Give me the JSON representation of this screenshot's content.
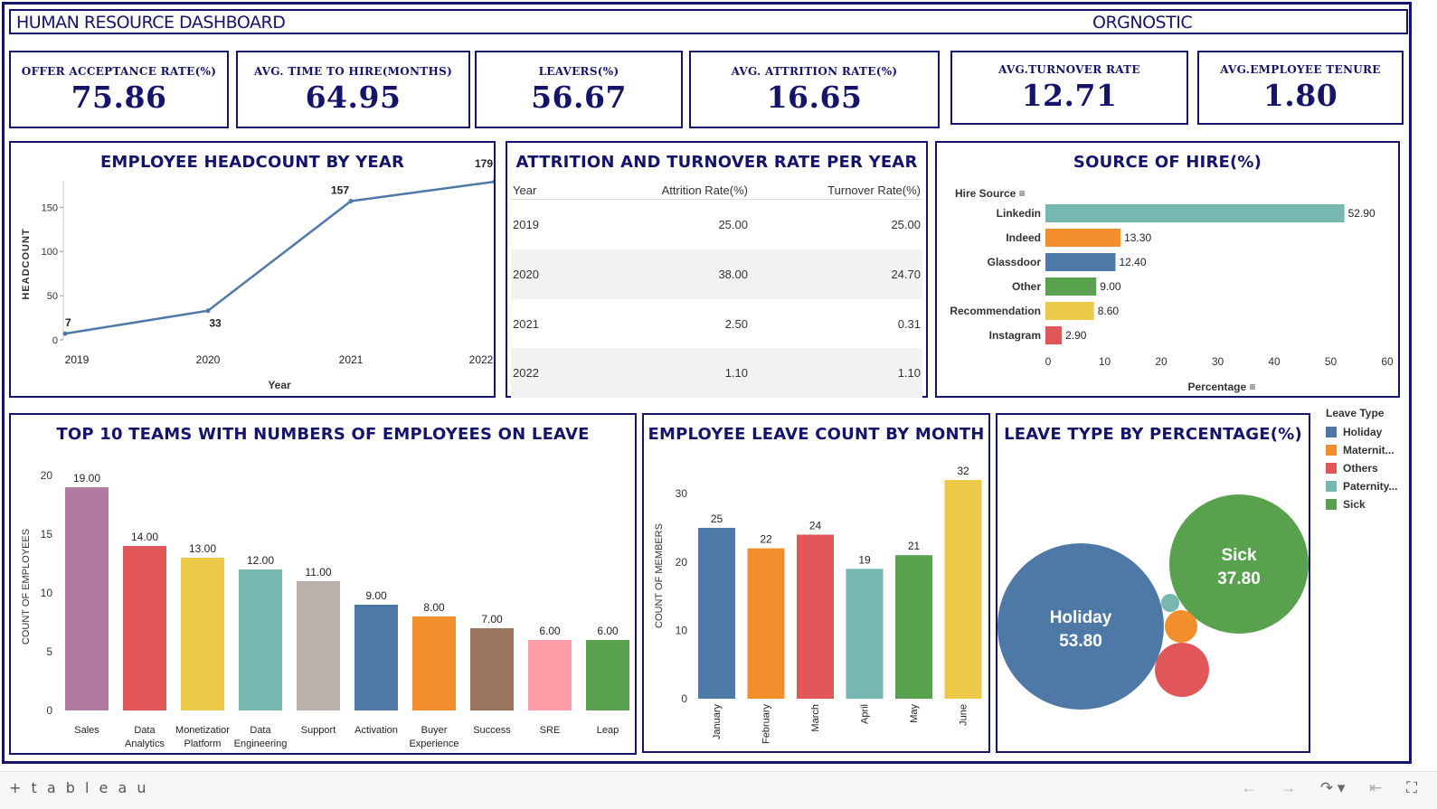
{
  "header": {
    "title": "HUMAN RESOURCE DASHBOARD",
    "org": "ORGNOSTIC"
  },
  "kpis": [
    {
      "label": "OFFER ACCEPTANCE RATE(%)",
      "value": "75.86"
    },
    {
      "label": "AVG. TIME TO HIRE(MONTHS)",
      "value": "64.95"
    },
    {
      "label": "LEAVERS(%)",
      "value": "56.67"
    },
    {
      "label": "AVG. ATTRITION RATE(%)",
      "value": "16.65"
    },
    {
      "label": "AVG.TURNOVER RATE",
      "value": "12.71"
    },
    {
      "label": "AVG.EMPLOYEE TENURE",
      "value": "1.80"
    }
  ],
  "headcount": {
    "title": "EMPLOYEE HEADCOUNT BY YEAR",
    "chart_data": {
      "type": "line",
      "x": [
        "2019",
        "2020",
        "2021",
        "2022"
      ],
      "values": [
        7,
        33,
        157,
        179
      ],
      "xlabel": "Year",
      "ylabel": "HEADCOUNT",
      "yticks": [
        0,
        50,
        100,
        150
      ],
      "ylim": [
        0,
        180
      ],
      "color": "#4e79a7"
    }
  },
  "attrition": {
    "title": "ATTRITION AND TURNOVER RATE PER YEAR",
    "columns": [
      "Year",
      "Attrition Rate(%)",
      "Turnover Rate(%)"
    ],
    "rows": [
      [
        "2019",
        "25.00",
        "25.00"
      ],
      [
        "2020",
        "38.00",
        "24.70"
      ],
      [
        "2021",
        "2.50",
        "0.31"
      ],
      [
        "2022",
        "1.10",
        "1.10"
      ]
    ]
  },
  "source": {
    "title": "SOURCE OF HIRE(%)",
    "header_label": "Hire Source",
    "chart_data": {
      "type": "bar",
      "orientation": "horizontal",
      "categories": [
        "Linkedin",
        "Indeed",
        "Glassdoor",
        "Other",
        "Recommendation",
        "Instagram"
      ],
      "values": [
        52.9,
        13.3,
        12.4,
        9.0,
        8.6,
        2.9
      ],
      "labels": [
        "52.90",
        "13.30",
        "12.40",
        "9.00",
        "8.60",
        "2.90"
      ],
      "colors": [
        "#76b7b2",
        "#f28e2b",
        "#4e79a7",
        "#59a14f",
        "#edc948",
        "#e15759"
      ],
      "xlabel": "Percentage",
      "xticks": [
        0,
        10,
        20,
        30,
        40,
        50,
        60
      ],
      "xlim": [
        0,
        60
      ]
    }
  },
  "teams": {
    "title": "TOP 10 TEAMS WITH NUMBERS OF EMPLOYEES ON LEAVE",
    "chart_data": {
      "type": "bar",
      "categories": [
        [
          "Sales"
        ],
        [
          "Data",
          "Analytics"
        ],
        [
          "Monetizatior",
          "Platform"
        ],
        [
          "Data",
          "Engineering"
        ],
        [
          "Support"
        ],
        [
          "Activation"
        ],
        [
          "Buyer",
          "Experience"
        ],
        [
          "Success"
        ],
        [
          "SRE"
        ],
        [
          "Leap"
        ]
      ],
      "values": [
        19,
        14,
        13,
        12,
        11,
        9,
        8,
        7,
        6,
        6
      ],
      "labels": [
        "19.00",
        "14.00",
        "13.00",
        "12.00",
        "11.00",
        "9.00",
        "8.00",
        "7.00",
        "6.00",
        "6.00"
      ],
      "colors": [
        "#b07aa1",
        "#e15759",
        "#edc948",
        "#76b7b2",
        "#bab0ac",
        "#4e79a7",
        "#f28e2b",
        "#9c755f",
        "#ff9da7",
        "#59a14f"
      ],
      "ylabel": "COUNT OF EMPLOYEES",
      "yticks": [
        0,
        5,
        10,
        15,
        20
      ],
      "ylim": [
        0,
        20
      ]
    }
  },
  "monthly": {
    "title": "EMPLOYEE LEAVE COUNT  BY MONTH",
    "chart_data": {
      "type": "bar",
      "categories": [
        "January",
        "February",
        "March",
        "April",
        "May",
        "June"
      ],
      "values": [
        25,
        22,
        24,
        19,
        21,
        32
      ],
      "colors": [
        "#4e79a7",
        "#f28e2b",
        "#e15759",
        "#76b7b2",
        "#59a14f",
        "#edc948"
      ],
      "ylabel": "COUNT OF MEMBERS",
      "yticks": [
        0,
        10,
        20,
        30
      ],
      "ylim": [
        0,
        32
      ]
    }
  },
  "leave_type": {
    "title": "LEAVE TYPE BY PERCENTAGE(%)",
    "chart_data": {
      "type": "bubble",
      "categories": [
        "Holiday",
        "Sick",
        "Paternity...",
        "Materni...",
        "Others"
      ],
      "values": [
        53.8,
        37.8,
        null,
        null,
        null
      ],
      "labels": [
        "53.80",
        "37.80",
        "",
        "",
        ""
      ],
      "colors": [
        "#4e79a7",
        "#59a14f",
        "#76b7b2",
        "#f28e2b",
        "#e15759"
      ]
    },
    "legend_title": "Leave Type",
    "legend": [
      {
        "label": "Holiday",
        "color": "#4e79a7"
      },
      {
        "label": "Maternit...",
        "color": "#f28e2b"
      },
      {
        "label": "Others",
        "color": "#e15759"
      },
      {
        "label": "Paternity...",
        "color": "#76b7b2"
      },
      {
        "label": "Sick",
        "color": "#59a14f"
      }
    ]
  },
  "footer": {
    "logo": "+ t a b l e a u",
    "icons": [
      "undo-icon",
      "redo-icon",
      "share-icon",
      "revert-icon",
      "fullscreen-icon"
    ]
  }
}
